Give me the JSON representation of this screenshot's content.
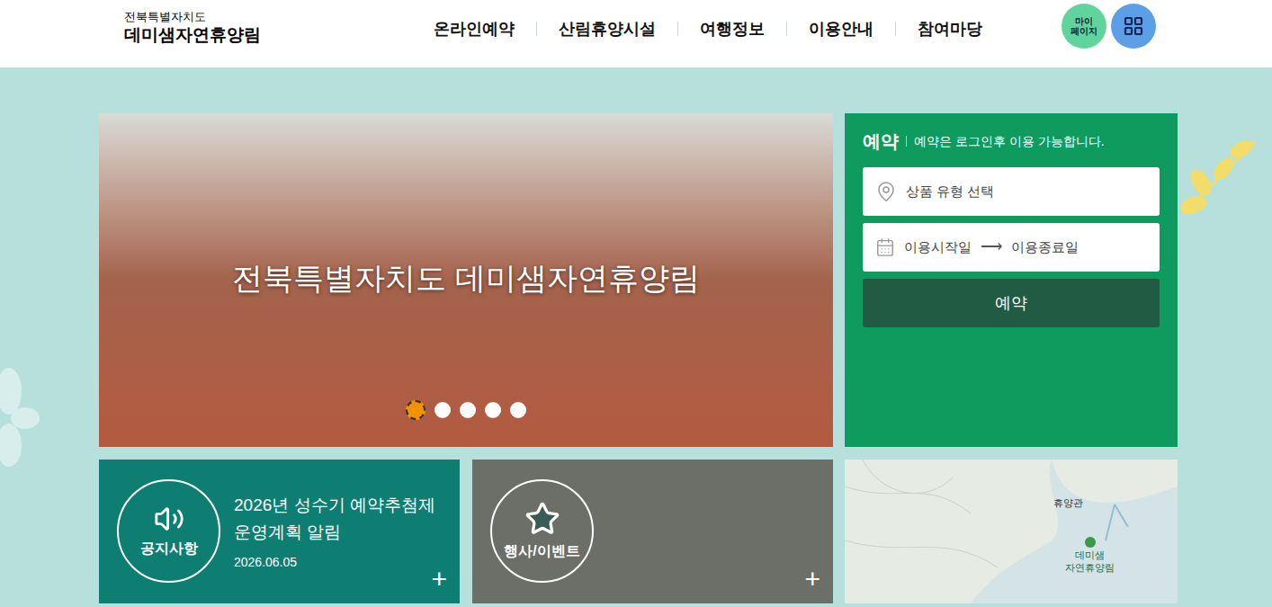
{
  "header": {
    "region": "전북특별자치도",
    "site_name": "데미샘자연휴양림",
    "nav": [
      {
        "label": "온라인예약"
      },
      {
        "label": "산림휴양시설"
      },
      {
        "label": "여행정보"
      },
      {
        "label": "이용안내"
      },
      {
        "label": "참여마당"
      }
    ],
    "mypage_lines": [
      "마이",
      "페이지"
    ]
  },
  "hero": {
    "caption": "전북특별자치도 데미샘자연휴양림",
    "slides": [
      {
        "selected": true
      },
      {
        "selected": false
      },
      {
        "selected": false
      },
      {
        "selected": false
      },
      {
        "selected": false
      }
    ]
  },
  "reservation": {
    "title": "예약",
    "note": "예약은 로그인후 이용 가능합니다.",
    "product_placeholder": "상품 유형 선택",
    "start_placeholder": "이용시작일",
    "arrow": "⟶",
    "end_placeholder": "이용종료일",
    "button": "예약"
  },
  "notice": {
    "label": "공지사항",
    "title": "2026년 성수기 예약추첨제 운영계획 알림",
    "date": "2026.06.05",
    "more": "+"
  },
  "events": {
    "label": "행사/이벤트",
    "more": "+"
  },
  "map": {
    "labels": [
      "휴양관",
      "데미샘\n자연휴양림"
    ]
  }
}
